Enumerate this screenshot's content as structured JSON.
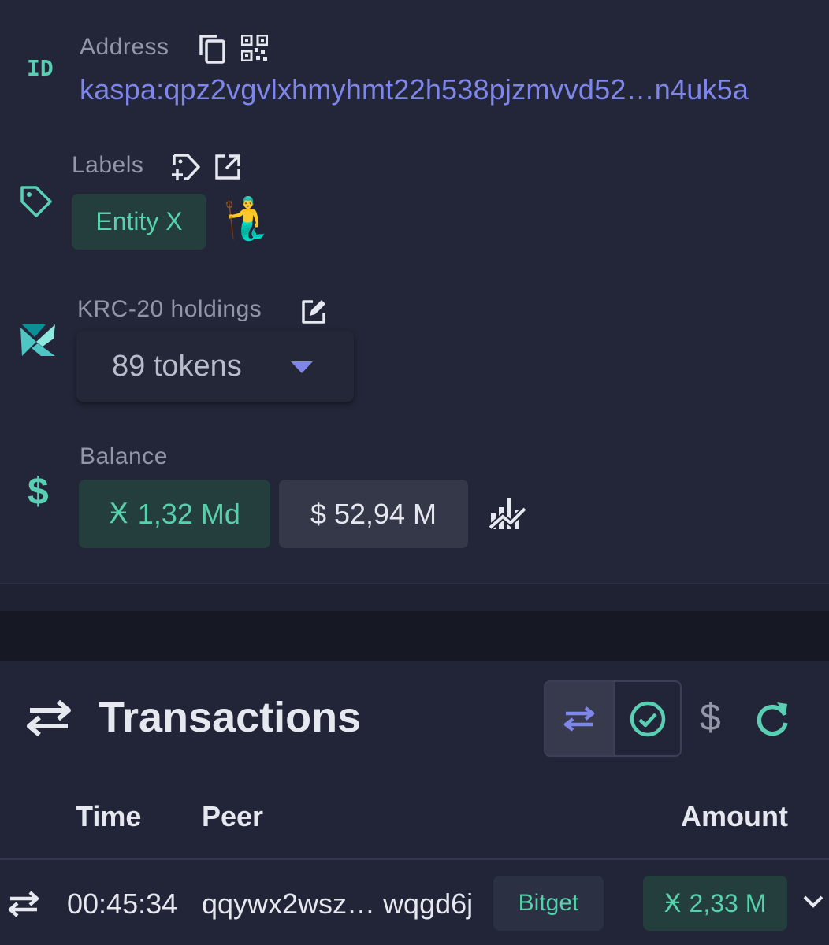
{
  "address": {
    "label": "Address",
    "id_icon_text": "ID",
    "value": "kaspa:qpz2vgvlxhmyhmt22h538pjzmvvd52…n4uk5a"
  },
  "labels": {
    "label": "Labels",
    "tag": "Entity X",
    "emoji": "🧜‍♂️"
  },
  "krc20": {
    "label": "KRC-20 holdings",
    "selected": "89 tokens"
  },
  "balance": {
    "label": "Balance",
    "kas": "₭ 1,32 Md",
    "kas_symbol": "Ӿ",
    "kas_value": "1,32 Md",
    "usd": "$ 52,94 M"
  },
  "transactions": {
    "title": "Transactions",
    "columns": {
      "time": "Time",
      "peer": "Peer",
      "amount": "Amount"
    },
    "rows": [
      {
        "time": "00:45:34",
        "peer": "qqywx2wsz… wqgd6j",
        "peer_tag": "Bitget",
        "amount_symbol": "Ӿ",
        "amount": "2,33 M"
      }
    ]
  },
  "icons": {
    "copy": "copy-icon",
    "qr": "qr-code-icon",
    "tag": "tag-icon",
    "add_label": "add-label-icon",
    "open_external": "open-external-icon",
    "edit": "edit-icon",
    "krc": "krc-logo-icon",
    "dollar": "dollar-icon",
    "chart": "chart-icon",
    "transfer": "transfer-icon",
    "check_circle": "check-circle-icon",
    "refresh": "refresh-icon",
    "chevron": "chevron-down-icon"
  },
  "colors": {
    "background": "#1f2233",
    "accent_teal": "#59d0b3",
    "accent_blue": "#7f86ea",
    "chip_green_bg": "#243e3e",
    "chip_grey_bg": "#353848"
  }
}
